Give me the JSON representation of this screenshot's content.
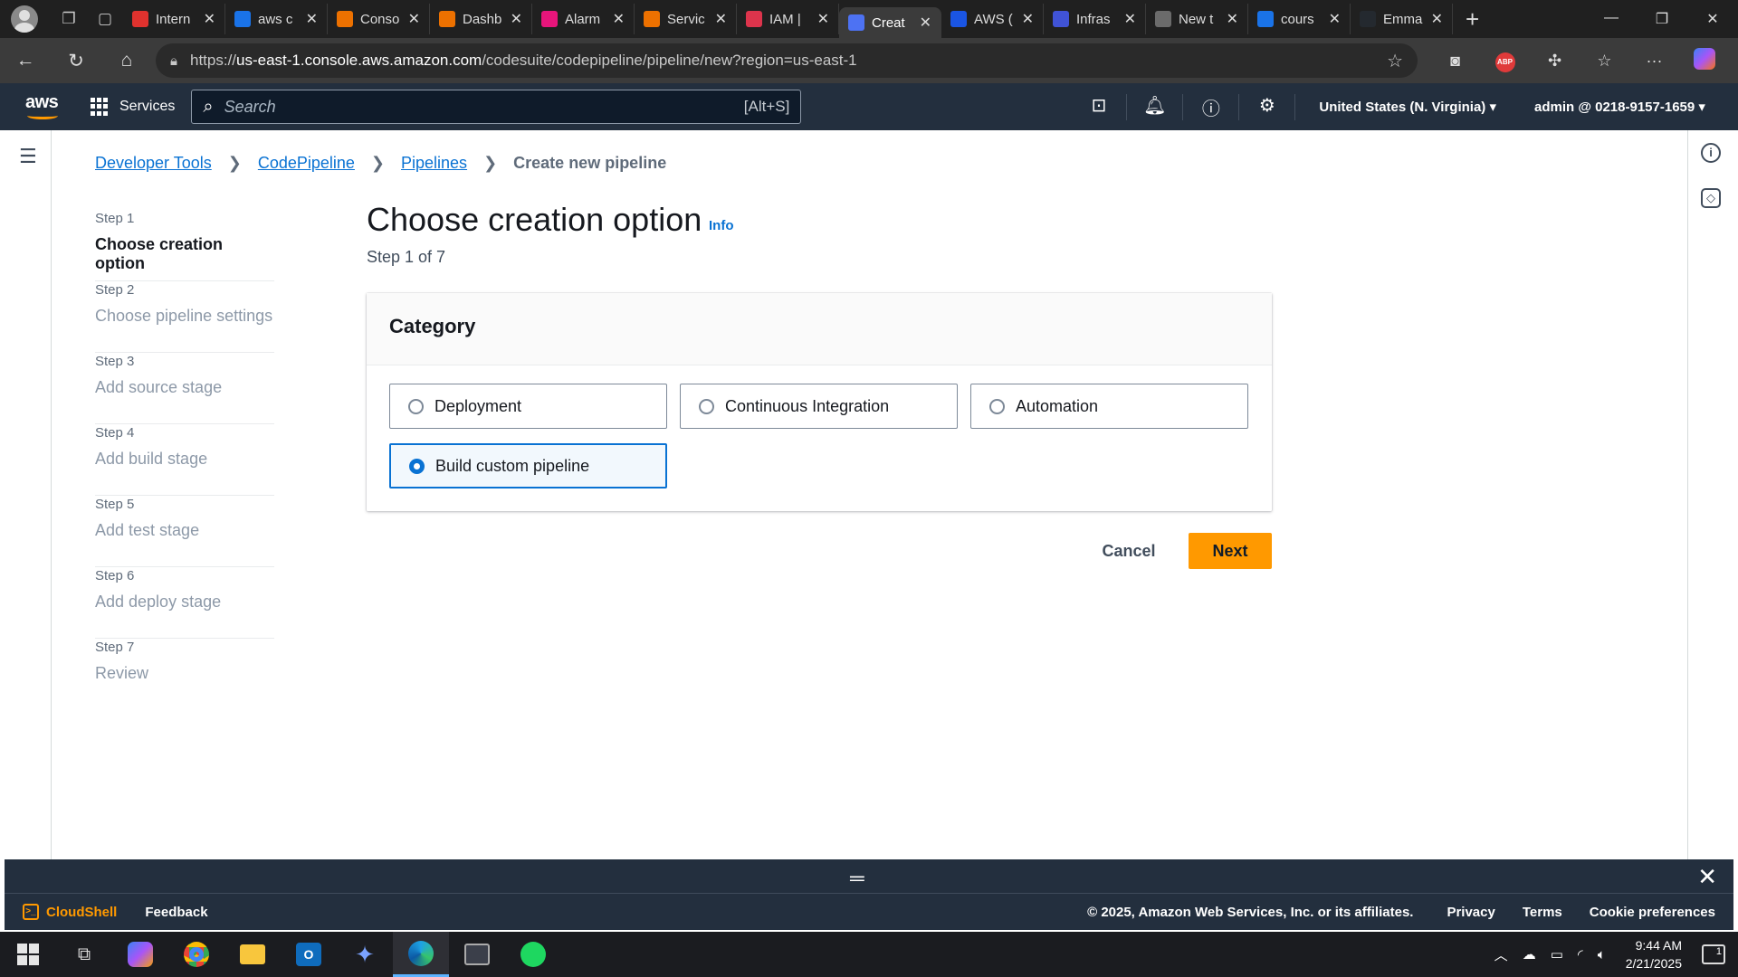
{
  "browser": {
    "tabs": [
      {
        "label": "Intern",
        "color": "#e0322e"
      },
      {
        "label": "aws c",
        "color": "#1a73e8"
      },
      {
        "label": "Conso",
        "color": "#ed7100"
      },
      {
        "label": "Dashb",
        "color": "#ed7100"
      },
      {
        "label": "Alarm",
        "color": "#e7157b"
      },
      {
        "label": "Servic",
        "color": "#ed7100"
      },
      {
        "label": "IAM |",
        "color": "#dd344c"
      },
      {
        "label": "Creat",
        "color": "#4d72f3",
        "active": true
      },
      {
        "label": "AWS (",
        "color": "#1a55e3"
      },
      {
        "label": "Infras",
        "color": "#4053d6"
      },
      {
        "label": "New t",
        "color": "#6b6b6b"
      },
      {
        "label": "cours",
        "color": "#1a73e8"
      },
      {
        "label": "Emma",
        "color": "#24292f"
      }
    ],
    "url_prefix": "https://",
    "url_host": "us-east-1.console.aws.amazon.com",
    "url_path": "/codesuite/codepipeline/pipeline/new?region=us-east-1"
  },
  "aws_nav": {
    "logo": "aws",
    "services_label": "Services",
    "search_placeholder": "Search",
    "search_hint": "[Alt+S]",
    "region": "United States (N. Virginia) ▾",
    "account": "admin @ 0218-9157-1659 ▾"
  },
  "breadcrumb": {
    "items": [
      "Developer Tools",
      "CodePipeline",
      "Pipelines"
    ],
    "current": "Create new pipeline"
  },
  "wizard": {
    "steps": [
      {
        "num": "Step 1",
        "label": "Choose creation option",
        "active": true
      },
      {
        "num": "Step 2",
        "label": "Choose pipeline settings"
      },
      {
        "num": "Step 3",
        "label": "Add source stage"
      },
      {
        "num": "Step 4",
        "label": "Add build stage"
      },
      {
        "num": "Step 5",
        "label": "Add test stage"
      },
      {
        "num": "Step 6",
        "label": "Add deploy stage"
      },
      {
        "num": "Step 7",
        "label": "Review"
      }
    ]
  },
  "main": {
    "title": "Choose creation option",
    "info": "Info",
    "subtitle": "Step 1 of 7",
    "category_title": "Category",
    "options": [
      "Deployment",
      "Continuous Integration",
      "Automation",
      "Build custom pipeline"
    ],
    "selected_option": "Build custom pipeline",
    "cancel_label": "Cancel",
    "next_label": "Next"
  },
  "footer": {
    "cloudshell": "CloudShell",
    "feedback": "Feedback",
    "copyright": "© 2025, Amazon Web Services, Inc. or its affiliates.",
    "privacy": "Privacy",
    "terms": "Terms",
    "cookies": "Cookie preferences"
  },
  "taskbar": {
    "time": "9:44 AM",
    "date": "2/21/2025",
    "notification_count": "1"
  },
  "colors": {
    "aws_nav_bg": "#232f3e",
    "accent_orange": "#ff9900",
    "link_blue": "#0972d3"
  }
}
